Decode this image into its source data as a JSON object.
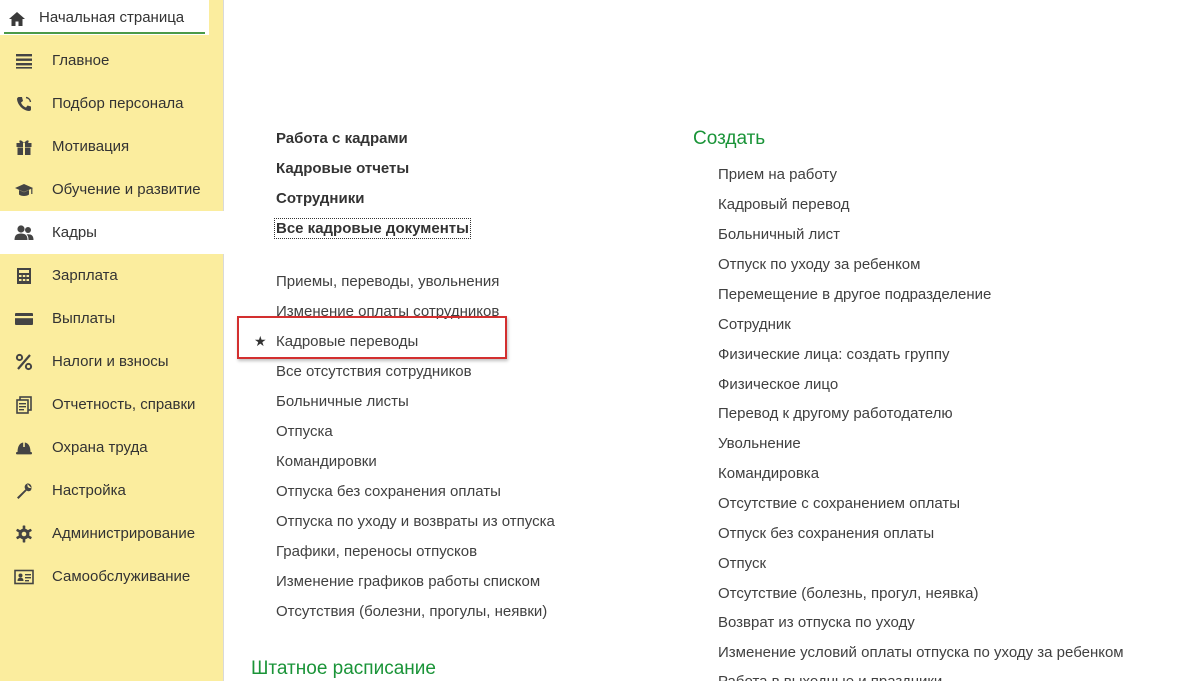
{
  "home_tab": {
    "label": "Начальная страница",
    "icon": "home-icon"
  },
  "sidebar": {
    "items": [
      {
        "label": "Главное",
        "icon": "menu-lines-icon"
      },
      {
        "label": "Подбор персонала",
        "icon": "phone-icon"
      },
      {
        "label": "Мотивация",
        "icon": "gift-icon"
      },
      {
        "label": "Обучение и развитие",
        "icon": "graduation-cap-icon"
      },
      {
        "label": "Кадры",
        "icon": "people-icon",
        "active": true
      },
      {
        "label": "Зарплата",
        "icon": "calculator-icon"
      },
      {
        "label": "Выплаты",
        "icon": "card-icon"
      },
      {
        "label": "Налоги и взносы",
        "icon": "percent-icon"
      },
      {
        "label": "Отчетность, справки",
        "icon": "documents-icon"
      },
      {
        "label": "Охрана труда",
        "icon": "helmet-icon"
      },
      {
        "label": "Настройка",
        "icon": "wrench-icon"
      },
      {
        "label": "Администрирование",
        "icon": "gear-icon"
      },
      {
        "label": "Самообслуживание",
        "icon": "id-card-icon"
      }
    ]
  },
  "main": {
    "bold_links": [
      "Работа с кадрами",
      "Кадровые отчеты",
      "Сотрудники",
      "Все кадровые документы"
    ],
    "links": [
      "Приемы, переводы, увольнения",
      "Изменение оплаты сотрудников",
      "Кадровые переводы",
      "Все отсутствия сотрудников",
      "Больничные листы",
      "Отпуска",
      "Командировки",
      "Отпуска без сохранения оплаты",
      "Отпуска по уходу и возвраты из отпуска",
      "Графики, переносы отпусков",
      "Изменение графиков работы списком",
      "Отсутствия (болезни, прогулы, неявки)"
    ],
    "star": "★",
    "staff_schedule_title": "Штатное расписание",
    "create_title": "Создать",
    "create_links": [
      "Прием на работу",
      "Кадровый перевод",
      "Больничный лист",
      "Отпуск по уходу за ребенком",
      "Перемещение в другое подразделение",
      "Сотрудник",
      "Физические лица: создать группу",
      "Физическое лицо",
      "Перевод к другому работодателю",
      "Увольнение",
      "Командировка",
      "Отсутствие с сохранением оплаты",
      "Отпуск без сохранения оплаты",
      "Отпуск",
      "Отсутствие (болезнь, прогул, неявка)",
      "Возврат из отпуска по уходу",
      "Изменение условий оплаты отпуска по уходу за ребенком",
      "Работа в выходные и праздники"
    ]
  },
  "colors": {
    "sidebar_bg": "#fbed9e",
    "section_green": "#1a9438",
    "highlight_red": "#d32f2f"
  }
}
